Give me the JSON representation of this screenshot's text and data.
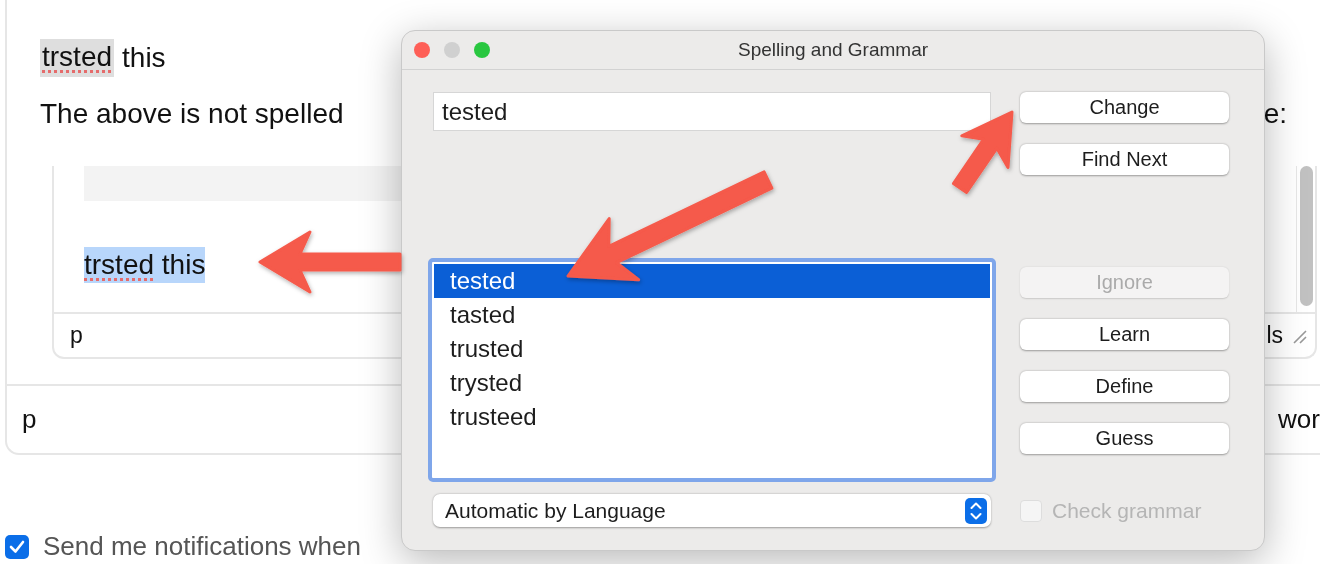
{
  "editor": {
    "first_line": {
      "word": "trsted",
      "rest": "this"
    },
    "paragraph": {
      "start": "The above is not spelled",
      "end": "e:"
    },
    "preview": {
      "word": "trsted",
      "rest": "this",
      "footer_left": "p",
      "footer_right": "ls"
    },
    "footer_left": "p",
    "footer_right": "wor"
  },
  "notify": {
    "label": "Send me notifications when",
    "checked": true
  },
  "dialog": {
    "title": "Spelling and Grammar",
    "word": "tested",
    "buttons": [
      {
        "label": "Change",
        "disabled": false
      },
      {
        "label": "Find Next",
        "disabled": false
      },
      {
        "label": "Ignore",
        "disabled": true
      },
      {
        "label": "Learn",
        "disabled": false
      },
      {
        "label": "Define",
        "disabled": false
      },
      {
        "label": "Guess",
        "disabled": false
      }
    ],
    "guesses": [
      {
        "label": "tested",
        "selected": true
      },
      {
        "label": "tasted",
        "selected": false
      },
      {
        "label": "trusted",
        "selected": false
      },
      {
        "label": "trysted",
        "selected": false
      },
      {
        "label": "trusteed",
        "selected": false
      }
    ],
    "language": "Automatic by Language",
    "check_grammar": {
      "label": "Check grammar",
      "checked": false,
      "disabled": true
    }
  }
}
